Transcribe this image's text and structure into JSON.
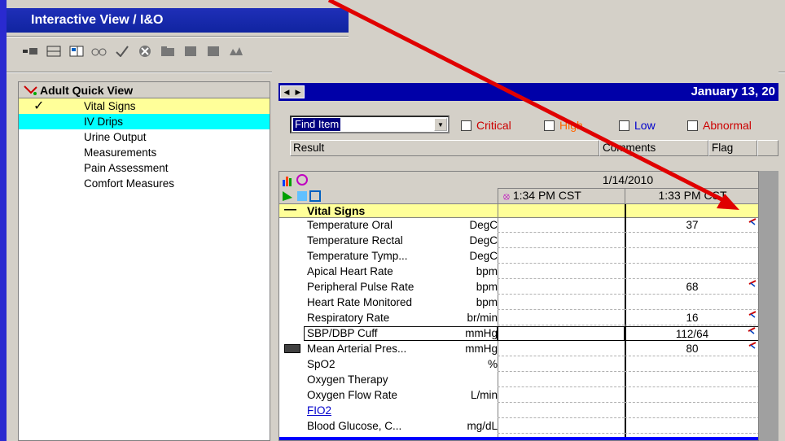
{
  "window": {
    "title": "Interactive View / I&O"
  },
  "navigator": {
    "header": "Adult Quick View",
    "items": [
      {
        "label": "Vital Signs",
        "state": "checked"
      },
      {
        "label": "IV Drips",
        "state": "active"
      },
      {
        "label": "Urine Output",
        "state": ""
      },
      {
        "label": "Measurements",
        "state": ""
      },
      {
        "label": "Pain Assessment",
        "state": ""
      },
      {
        "label": "Comfort Measures",
        "state": ""
      }
    ]
  },
  "date_bar": {
    "date": "January 13, 20"
  },
  "filter": {
    "find_item_value": "Find Item",
    "options": [
      "Critical",
      "High",
      "Low",
      "Abnormal"
    ],
    "option_colors": [
      "#cc0000",
      "#ff6600",
      "#0000cc",
      "#cc0000"
    ]
  },
  "columns": {
    "result": "Result",
    "comments": "Comments",
    "flag": "Flag"
  },
  "grid": {
    "date_header": "1/14/2010",
    "col1_time": "1:34 PM CST",
    "col2_time": "1:33 PM CST",
    "section": "Vital Signs",
    "rows": [
      {
        "name": "Temperature Oral",
        "unit": "DegC",
        "value": "37",
        "flag": true
      },
      {
        "name": "Temperature Rectal",
        "unit": "DegC",
        "value": "",
        "flag": false
      },
      {
        "name": "Temperature Tymp...",
        "unit": "DegC",
        "value": "",
        "flag": false
      },
      {
        "name": "Apical Heart Rate",
        "unit": "bpm",
        "value": "",
        "flag": false
      },
      {
        "name": "Peripheral Pulse Rate",
        "unit": "bpm",
        "value": "68",
        "flag": true
      },
      {
        "name": "Heart Rate Monitored",
        "unit": "bpm",
        "value": "",
        "flag": false
      },
      {
        "name": "Respiratory Rate",
        "unit": "br/min",
        "value": "16",
        "flag": true
      },
      {
        "name": "SBP/DBP Cuff",
        "unit": "mmHg",
        "value": "112/64",
        "flag": true
      },
      {
        "name": "Mean Arterial Pres...",
        "unit": "mmHg",
        "value": "80",
        "flag": true
      },
      {
        "name": "SpO2",
        "unit": "%",
        "value": "",
        "flag": false
      },
      {
        "name": "Oxygen Therapy",
        "unit": "",
        "value": "",
        "flag": false
      },
      {
        "name": "Oxygen Flow Rate",
        "unit": "L/min",
        "value": "",
        "flag": false
      },
      {
        "name": "FIO2",
        "unit": "",
        "value": "",
        "flag": false
      },
      {
        "name": "Blood Glucose, C...",
        "unit": "mg/dL",
        "value": "",
        "flag": false
      }
    ]
  },
  "colors": {
    "accent_red": "#e00000",
    "nav_selected": "#ffff99",
    "nav_active": "#00ffff"
  }
}
